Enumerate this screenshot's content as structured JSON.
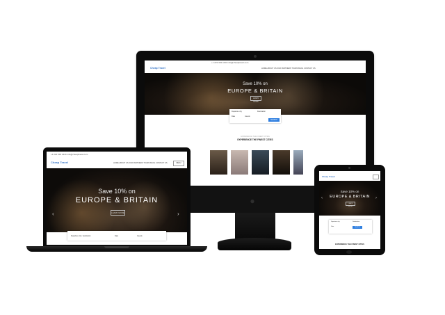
{
  "imac": {
    "topbar": "+1 222 333 4444   info@cheaptravel.com",
    "logo": "Cheap Travel",
    "menu": "HOME   ABOUT US   OUR PARTNERS   TOURS   BLOG   CONTACT US",
    "hero_save": "Save 10% on",
    "hero_title": "EUROPE & BRITAIN",
    "hero_button": "LEARN MORE",
    "search": {
      "from_label": "Departure city",
      "to_label": "Destination",
      "date_label": "Date",
      "guests_label": "Guests",
      "button": "SEARCH"
    },
    "section_kicker": "EXPERIENCE THE FINEST CITIES",
    "section_title": "EXPERIENCE THE FINEST CITIES"
  },
  "laptop": {
    "topbar": "+1 222 333 4444   info@cheaptravel.com",
    "logo": "Cheap Travel",
    "menu": "HOME   ABOUT US   OUR PARTNERS   TOURS   BLOG   CONTACT US",
    "menu_button": "MENU",
    "hero_save": "Save 10% on",
    "hero_title": "EUROPE & BRITAIN",
    "hero_button": "LEARN MORE",
    "search": {
      "from_label": "Departure city / destination",
      "date_label": "Date",
      "guests_label": "Guests"
    }
  },
  "tablet": {
    "logo": "Cheap Travel",
    "hero_save": "Save 10% on",
    "hero_title": "EUROPE & BRITAIN",
    "hero_button": "LEARN MORE",
    "search": {
      "from_label": "Departure city",
      "to_label": "Destination",
      "date_label": "Date",
      "button": "SEARCH"
    },
    "section_title": "EXPERIENCE THE FINEST CITIES"
  },
  "colors": {
    "accent": "#2f7fe0",
    "device_body": "#0b0b0b",
    "hero_dark": "#0c0a08"
  }
}
